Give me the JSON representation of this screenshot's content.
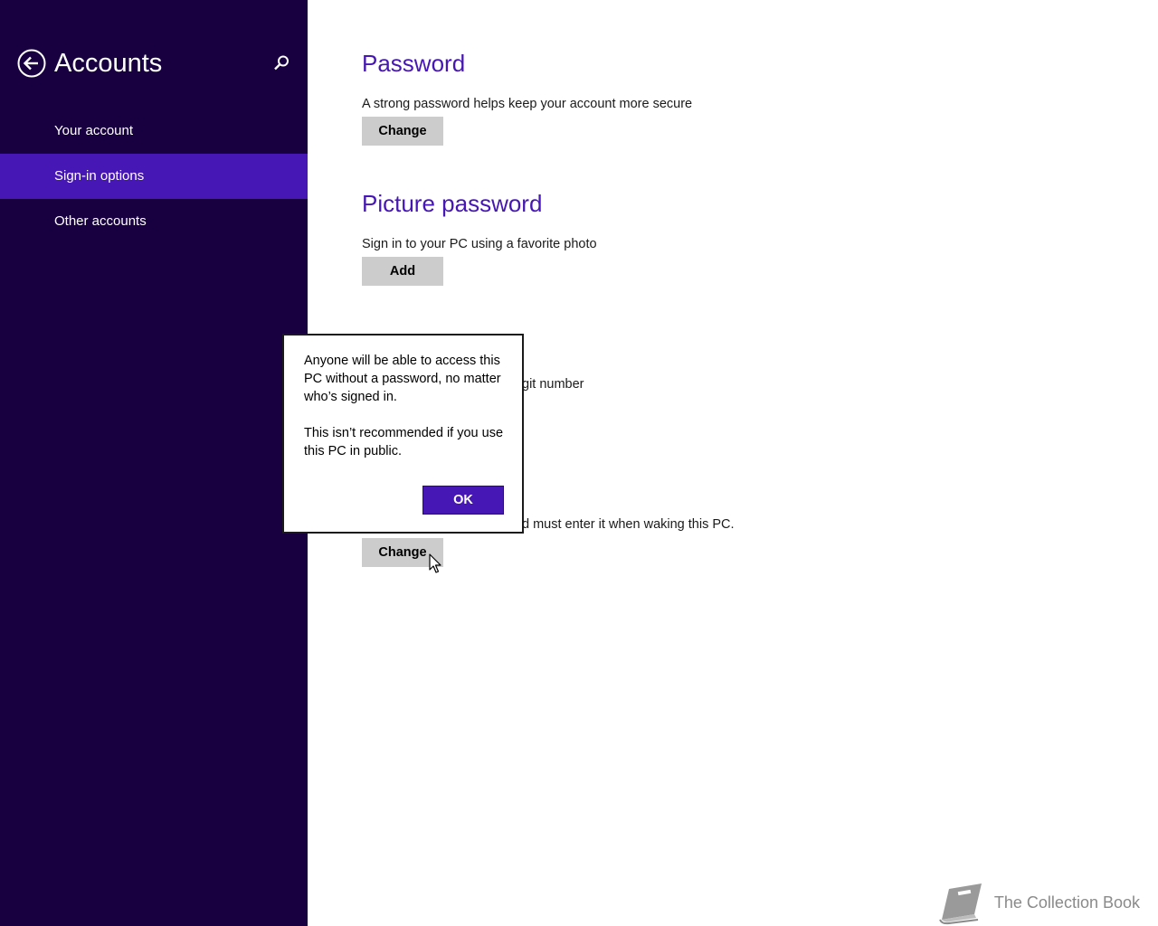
{
  "sidebar": {
    "title": "Accounts",
    "back_icon": "back-arrow-icon",
    "search_icon": "search-icon",
    "items": [
      {
        "label": "Your account",
        "selected": false
      },
      {
        "label": "Sign-in options",
        "selected": true
      },
      {
        "label": "Other accounts",
        "selected": false
      }
    ]
  },
  "main": {
    "password": {
      "title": "Password",
      "description": "A strong password helps keep your account more secure",
      "button": "Change"
    },
    "picture_password": {
      "title": "Picture password",
      "description": "Sign in to your PC using a favorite photo",
      "button": "Add"
    },
    "pin": {
      "description_fragment": "git number"
    },
    "password_policy": {
      "description_fragment": "d must enter it when waking this PC.",
      "button": "Change"
    }
  },
  "dialog": {
    "paragraph1": "Anyone will be able to access this PC without a password, no matter who’s signed in.",
    "paragraph2": "This isn’t recommended if you use this PC in public.",
    "ok_label": "OK"
  },
  "watermark": {
    "text": "The Collection Book",
    "icon": "book-icon"
  },
  "colors": {
    "sidebar_bg": "#180040",
    "selected_bg": "#4617b4",
    "accent": "#4617b4",
    "button_gray": "#cccccc"
  }
}
